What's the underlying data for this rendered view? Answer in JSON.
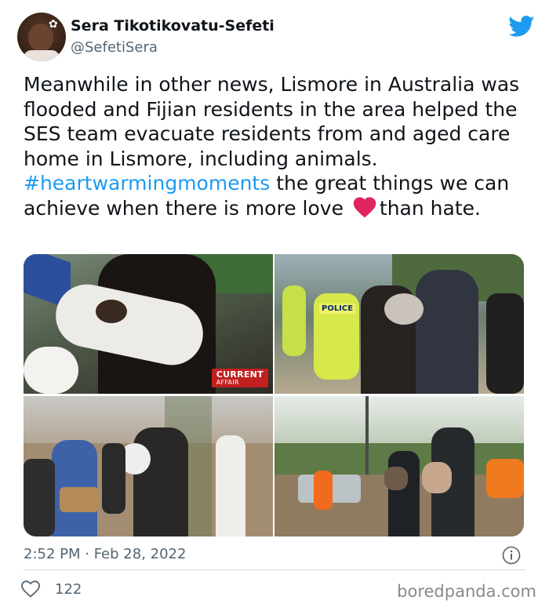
{
  "author": {
    "display_name": "Sera Tikotikovatu-Sefeti",
    "handle": "@SefetiSera",
    "avatar_icon": "profile-photo"
  },
  "platform_icon": "twitter-bird-icon",
  "tweet": {
    "text_part1": "Meanwhile in other news, Lismore in Australia was flooded and Fijian residents in the area helped the SES team evacuate residents from and aged care home in Lismore, including animals. ",
    "hashtag": "#heartwarmingmoments",
    "text_part2": " the great things we can achieve when there is more love ",
    "emoji": "red-heart",
    "text_part3": "than hate."
  },
  "media": {
    "photo1_badge": "CURRENT",
    "photo1_badge_sub": "AFFAIR",
    "photo2_sign": "POLICE"
  },
  "meta": {
    "timestamp": "2:52 PM · Feb 28, 2022"
  },
  "engagement": {
    "likes": "122"
  },
  "watermark": "boredpanda.com",
  "colors": {
    "link": "#1d9bf0",
    "secondary_text": "#536471",
    "heart": "#e0245e"
  }
}
